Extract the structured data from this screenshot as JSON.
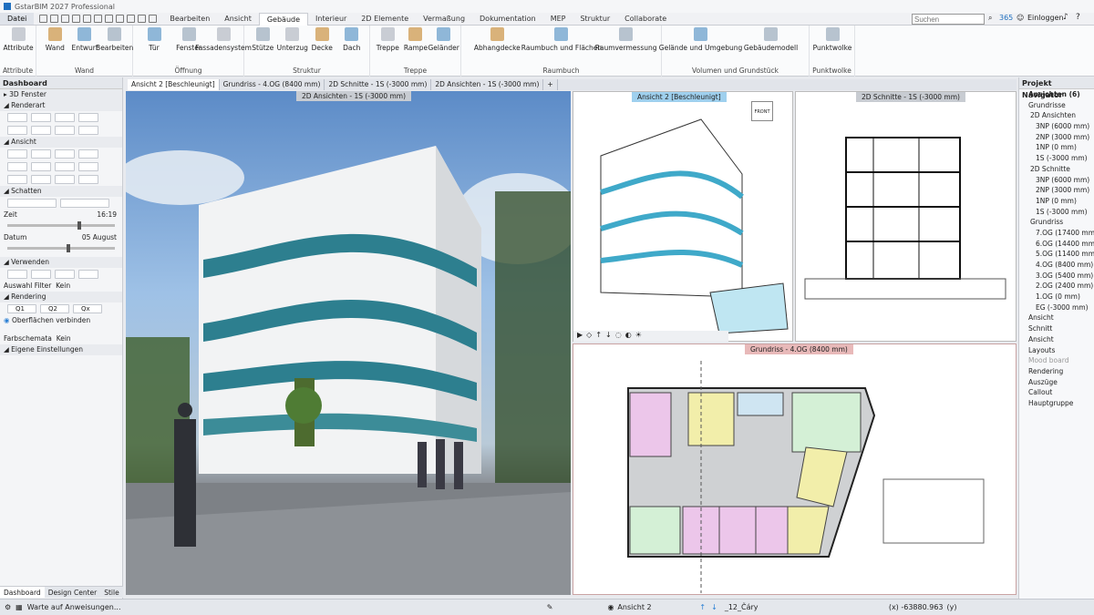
{
  "titlebar": {
    "title": "GstarBIM 2027 Professional"
  },
  "menu": {
    "file": "Datei",
    "tabs": [
      "Bearbeiten",
      "Ansicht",
      "Gebäude",
      "Interieur",
      "2D Elemente",
      "Vermaßung",
      "Dokumentation",
      "MEP",
      "Struktur",
      "Collaborate"
    ],
    "active_index": 2
  },
  "account": {
    "search_placeholder": "Suchen",
    "badge": "365",
    "login": "Einloggen"
  },
  "ribbon": {
    "groups": [
      {
        "label": "Attribute",
        "buttons": [
          "Attribute"
        ]
      },
      {
        "label": "Wand",
        "buttons": [
          "Wand",
          "Entwurf",
          "Bearbeiten"
        ]
      },
      {
        "label": "Öffnung",
        "buttons": [
          "Tür",
          "Fenster",
          "Fassadensystem"
        ]
      },
      {
        "label": "Struktur",
        "buttons": [
          "Stütze",
          "Unterzug",
          "Decke",
          "Dach"
        ]
      },
      {
        "label": "Treppe",
        "buttons": [
          "Treppe",
          "Rampe",
          "Geländer"
        ]
      },
      {
        "label": "Raumbuch",
        "buttons": [
          "Abhangdecke",
          "Raumbuch und Flächen",
          "Raumvermessung"
        ]
      },
      {
        "label": "Volumen und Grundstück",
        "buttons": [
          "Gelände und Umgebung",
          "Gebäudemodell"
        ]
      },
      {
        "label": "Punktwolke",
        "buttons": [
          "Punktwolke"
        ]
      }
    ]
  },
  "dashboard": {
    "title": "Dashboard",
    "fenster": "3D Fenster",
    "renderart": "Renderart",
    "ansicht": "Ansicht",
    "schatten": "Schatten",
    "zeit_label": "Zeit",
    "zeit_value": "16:19",
    "datum_label": "Datum",
    "datum_value": "05 August",
    "verwenden": "Verwenden",
    "filter_label": "Auswahl Filter",
    "filter_value": "Kein",
    "rendering": "Rendering",
    "q1": "Q1",
    "q2": "Q2",
    "qx": "Qx",
    "oberflaechen": "Oberflächen verbinden",
    "farbschemata_label": "Farbschemata",
    "farbschemata_value": "Kein",
    "eigene": "Eigene Einstellungen",
    "tabs": [
      "Dashboard",
      "Design Center",
      "Stile"
    ]
  },
  "view_tabs": [
    "Ansicht 2 [Beschleunigt]",
    "Grundriss - 4.OG (8400 mm)",
    "2D Schnitte - 1S (-3000 mm)",
    "2D Ansichten - 1S (-3000 mm)",
    "+"
  ],
  "views": {
    "main_label": "2D Ansichten - 1S (-3000 mm)",
    "view3d_label": "Ansicht 2 [Beschleunigt]",
    "section_label": "2D Schnitte - 1S (-3000 mm)",
    "plan_label": "Grundriss - 4.OG (8400 mm)",
    "cube_label": "FRONT"
  },
  "navigator": {
    "title": "Projekt Navigator",
    "items": [
      "Ansichten (6)",
      "Grundrisse",
      "2D Ansichten",
      "3NP (6000 mm)",
      "2NP (3000 mm)",
      "1NP (0 mm)",
      "1S (-3000 mm)",
      "2D Schnitte",
      "3NP (6000 mm)",
      "2NP (3000 mm)",
      "1NP (0 mm)",
      "1S (-3000 mm)",
      "Grundriss",
      "7.OG (17400 mm)",
      "6.OG (14400 mm)",
      "5.OG (11400 mm)",
      "4.OG (8400 mm)",
      "3.OG (5400 mm)",
      "2.OG (2400 mm)",
      "1.OG (0 mm)",
      "EG (-3000 mm)",
      "Ansicht",
      "Schnitt",
      "Ansicht",
      "Layouts",
      "Mood board",
      "Rendering",
      "Auszüge",
      "Callout",
      "Hauptgruppe"
    ]
  },
  "status": {
    "message": "Warte auf Anweisungen...",
    "view": "Ansicht 2",
    "layer": "_12_Čáry",
    "coords": "(x) -63880.963",
    "y_label": "(y)"
  },
  "colors": {
    "accent": "#2a7fd4",
    "ribbon_bg": "#fafbfc",
    "plan_border": "#c9a3a3"
  }
}
